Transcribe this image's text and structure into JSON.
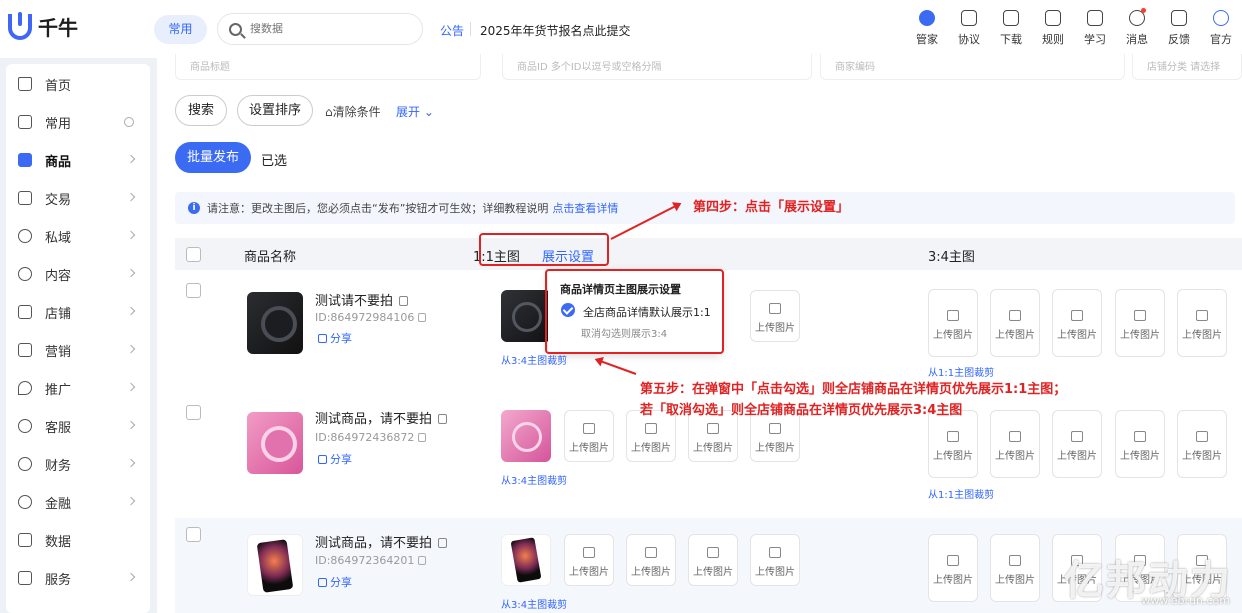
{
  "app": {
    "logo_text": "千牛"
  },
  "top": {
    "common_label": "常用",
    "search_placeholder": "搜数据",
    "notice_label": "公告",
    "notice_text": "2025年年货节报名点此提交",
    "tools": [
      {
        "icon": "butler-icon",
        "label": "管家",
        "dot": false
      },
      {
        "icon": "agreement-icon",
        "label": "协议",
        "dot": false
      },
      {
        "icon": "download-icon",
        "label": "下载",
        "dot": false
      },
      {
        "icon": "rules-icon",
        "label": "规则",
        "dot": false
      },
      {
        "icon": "learn-icon",
        "label": "学习",
        "dot": false
      },
      {
        "icon": "message-icon",
        "label": "消息",
        "dot": true
      },
      {
        "icon": "feedback-icon",
        "label": "反馈",
        "dot": false
      },
      {
        "icon": "official-icon",
        "label": "官方",
        "dot": false
      }
    ]
  },
  "sidebar": {
    "items": [
      {
        "label": "首页",
        "icon": "home-icon",
        "suffix": "none"
      },
      {
        "label": "常用",
        "icon": "common-icon",
        "suffix": "pin"
      },
      {
        "label": "商品",
        "icon": "goods-icon",
        "suffix": "chevron",
        "active": true
      },
      {
        "label": "交易",
        "icon": "trade-icon",
        "suffix": "chevron"
      },
      {
        "label": "私域",
        "icon": "private-icon",
        "suffix": "chevron"
      },
      {
        "label": "内容",
        "icon": "content-icon",
        "suffix": "chevron"
      },
      {
        "label": "店铺",
        "icon": "shop-icon",
        "suffix": "chevron"
      },
      {
        "label": "营销",
        "icon": "marketing-icon",
        "suffix": "chevron"
      },
      {
        "label": "推广",
        "icon": "promote-icon",
        "suffix": "chevron"
      },
      {
        "label": "客服",
        "icon": "service-icon",
        "suffix": "chevron"
      },
      {
        "label": "财务",
        "icon": "finance-icon",
        "suffix": "chevron"
      },
      {
        "label": "金融",
        "icon": "bank-icon",
        "suffix": "chevron"
      },
      {
        "label": "数据",
        "icon": "data-icon",
        "suffix": "none"
      },
      {
        "label": "服务",
        "icon": "services-icon",
        "suffix": "chevron"
      }
    ]
  },
  "filters": {
    "fields": [
      "商品标题",
      "商品ID 多个ID以逗号或空格分隔",
      "商家编码",
      "店铺分类 请选择"
    ],
    "search_label": "搜索",
    "sort_label": "设置排序",
    "clear_label": "清除条件",
    "expand_label": "展开"
  },
  "actions": {
    "batch_publish": "批量发布",
    "selected": "已选"
  },
  "tip": {
    "text": "请注意：更改主图后，您必须点击“发布”按钮才可生效；详细教程说明",
    "link": "点击查看详情"
  },
  "table": {
    "col_name": "商品名称",
    "col_main_11": "1:1主图",
    "col_display_settings": "展示设置",
    "col_main_34": "3:4主图",
    "upload_label": "上传图片",
    "crop_from_34": "从3:4主图裁剪",
    "crop_from_11": "从1:1主图裁剪",
    "rows": [
      {
        "name": "测试请不要拍",
        "id": "ID:864972984106",
        "share": "分享",
        "image": "black-phone"
      },
      {
        "name": "测试商品，请不要拍",
        "id": "ID:864972436872",
        "share": "分享",
        "image": "pink-phone"
      },
      {
        "name": "测试商品，请不要拍",
        "id": "ID:864972364201",
        "share": "分享",
        "image": "se-phone"
      }
    ]
  },
  "popup": {
    "title": "商品详情页主图展示设置",
    "option": "全店商品详情默认展示1:1",
    "checked": true,
    "hint": "取消勾选则展示3:4"
  },
  "annotations": {
    "step4": "第四步：点击「展示设置」",
    "step5_line1": "第五步：在弹窗中「点击勾选」则全店铺商品在详情页优先展示1:1主图；",
    "step5_line2": "若「取消勾选」则全店铺商品在详情页优先展示3:4主图"
  },
  "watermark": {
    "brand": "亿邦动力",
    "url": "www.ebrun.com"
  },
  "colors": {
    "accent": "#3b6bf3",
    "annotation": "#e02222"
  }
}
